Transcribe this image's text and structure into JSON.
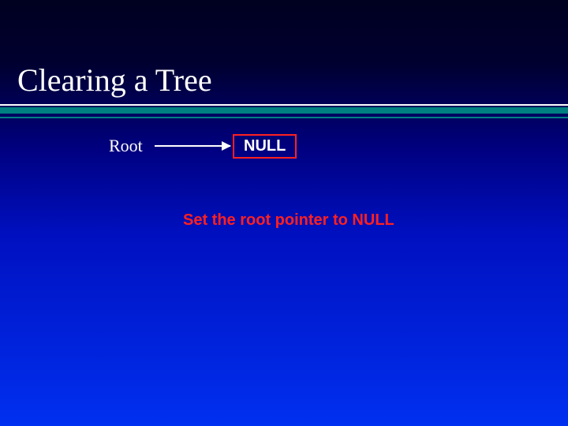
{
  "slide": {
    "title": "Clearing a Tree",
    "root_label": "Root",
    "null_label": "NULL",
    "caption": "Set the root pointer to NULL"
  }
}
